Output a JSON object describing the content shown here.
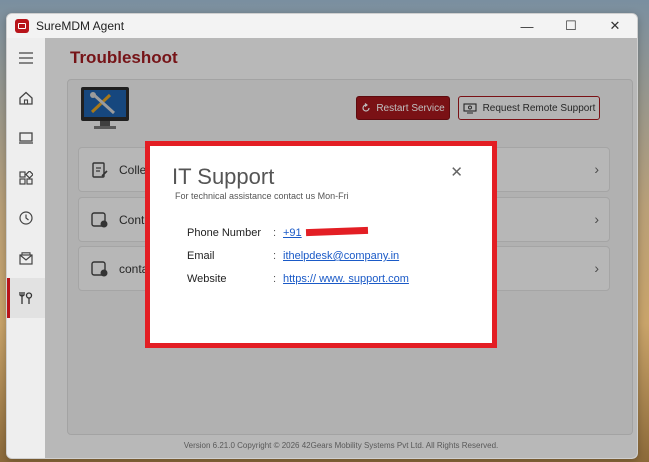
{
  "window": {
    "title": "SureMDM Agent",
    "minimize": "—",
    "maximize": "☐",
    "close": "✕"
  },
  "sidebar": {
    "items": [
      {
        "icon": "menu-icon"
      },
      {
        "icon": "home-icon"
      },
      {
        "icon": "device-icon"
      },
      {
        "icon": "apps-icon"
      },
      {
        "icon": "clock-icon"
      },
      {
        "icon": "mail-icon"
      },
      {
        "icon": "tools-icon",
        "active": true
      }
    ]
  },
  "page": {
    "title": "Troubleshoot",
    "restart_button": "Restart Service",
    "remote_button": "Request Remote Support",
    "list": [
      {
        "label": "Colle"
      },
      {
        "label": "Cont"
      },
      {
        "label": "conta"
      }
    ],
    "footer": "Version 6.21.0 Copyright © 2026 42Gears Mobility Systems Pvt Ltd. All Rights Reserved."
  },
  "dialog": {
    "title": "IT Support",
    "subtitle": "For technical assistance contact us Mon-Fri",
    "close": "✕",
    "rows": [
      {
        "label": "Phone Number",
        "sep": ":",
        "value": "+91"
      },
      {
        "label": "Email",
        "sep": ":",
        "value": "ithelpdesk@company.in"
      },
      {
        "label": "Website",
        "sep": ":",
        "value": "https:// www. support.com"
      }
    ]
  },
  "colors": {
    "accent": "#9e1b20",
    "highlight": "#e31e24",
    "link": "#1a5ac7"
  }
}
